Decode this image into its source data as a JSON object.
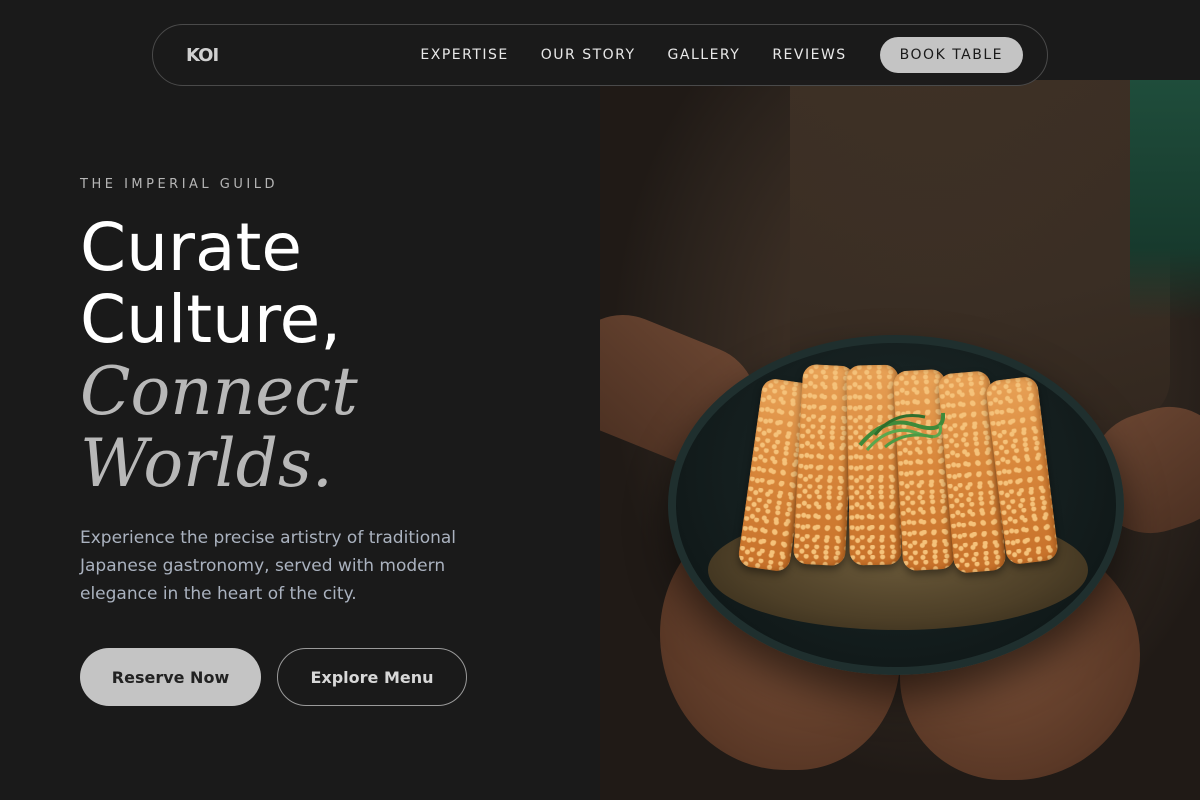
{
  "brand": {
    "logo": "KOI"
  },
  "nav": {
    "links": [
      "EXPERTISE",
      "OUR STORY",
      "GALLERY",
      "REVIEWS"
    ],
    "cta": "BOOK TABLE"
  },
  "hero": {
    "eyebrow": "THE IMPERIAL GUILD",
    "headline": {
      "line1": "Curate",
      "line2": "Culture,",
      "line3": "Connect",
      "line4": "Worlds."
    },
    "description": "Experience the precise artistry of traditional Japanese gastronomy, served with modern elegance in the heart of the city.",
    "primary_button": "Reserve Now",
    "secondary_button": "Explore Menu"
  },
  "image": {
    "subject": "chef-hands-holding-katsu-curry-bowl",
    "colors": {
      "apron": "#3b2e24",
      "cutlet": "#d9883c",
      "bowl": "#111a1a",
      "garnish": "#3f8a3a"
    }
  },
  "colors": {
    "background": "#1a1a1a",
    "accent_button": "#c4c4c4",
    "muted_text": "#aab2bf"
  }
}
